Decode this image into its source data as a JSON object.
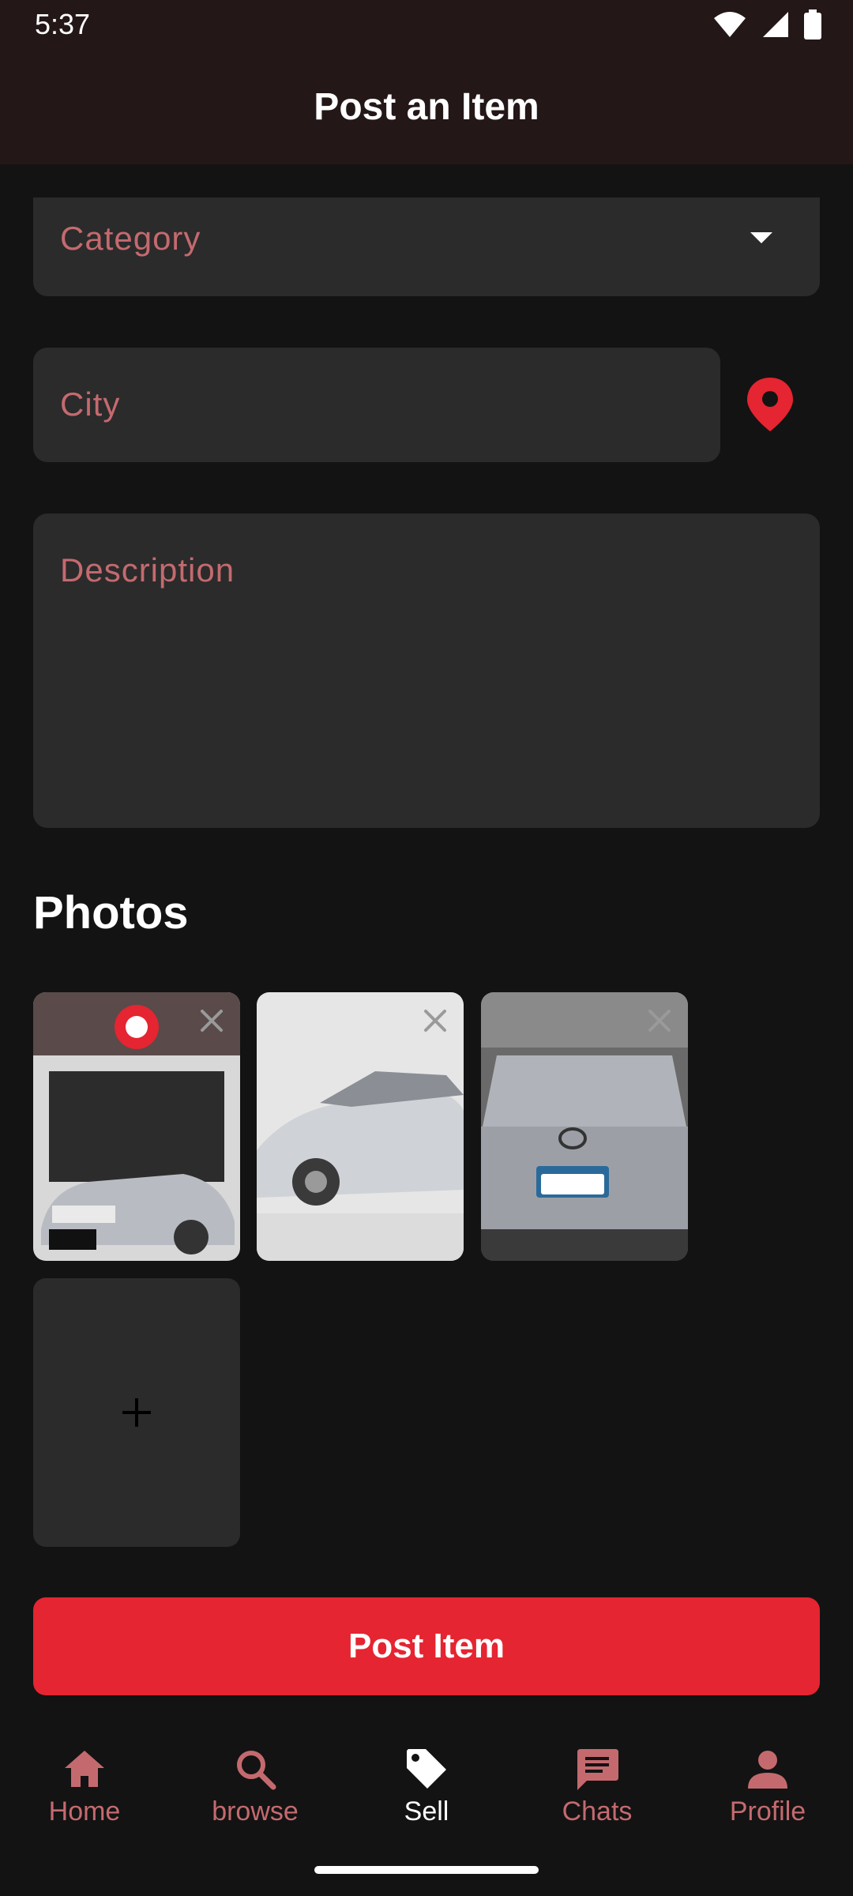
{
  "status_bar": {
    "time": "5:37",
    "icons": [
      "wifi-icon",
      "signal-icon",
      "battery-icon"
    ]
  },
  "app_bar": {
    "title": "Post an Item"
  },
  "form": {
    "category": {
      "placeholder": "Category",
      "icon": "dropdown-arrow-icon"
    },
    "city": {
      "placeholder": "City",
      "icon": "location-pin-icon"
    },
    "description": {
      "placeholder": "Description"
    }
  },
  "photos": {
    "title": "Photos",
    "items": [
      {
        "description": "Car dealership storefront with silver sedan",
        "remove_icon": "close-icon"
      },
      {
        "description": "Silver sedan side view",
        "remove_icon": "close-icon"
      },
      {
        "description": "Silver sedan front view",
        "remove_icon": "close-icon"
      }
    ],
    "add_icon": "plus-icon"
  },
  "post_button": {
    "label": "Post Item"
  },
  "bottom_nav": {
    "items": [
      {
        "label": "Home",
        "icon": "home-icon",
        "active": false
      },
      {
        "label": "browse",
        "icon": "search-icon",
        "active": false
      },
      {
        "label": "Sell",
        "icon": "tag-icon",
        "active": true
      },
      {
        "label": "Chats",
        "icon": "chat-icon",
        "active": false
      },
      {
        "label": "Profile",
        "icon": "person-icon",
        "active": false
      }
    ]
  },
  "colors": {
    "accent": "#e52531",
    "placeholder": "#c46a6f",
    "background": "#131313",
    "field": "#2b2b2b",
    "app_bar": "#241717"
  }
}
